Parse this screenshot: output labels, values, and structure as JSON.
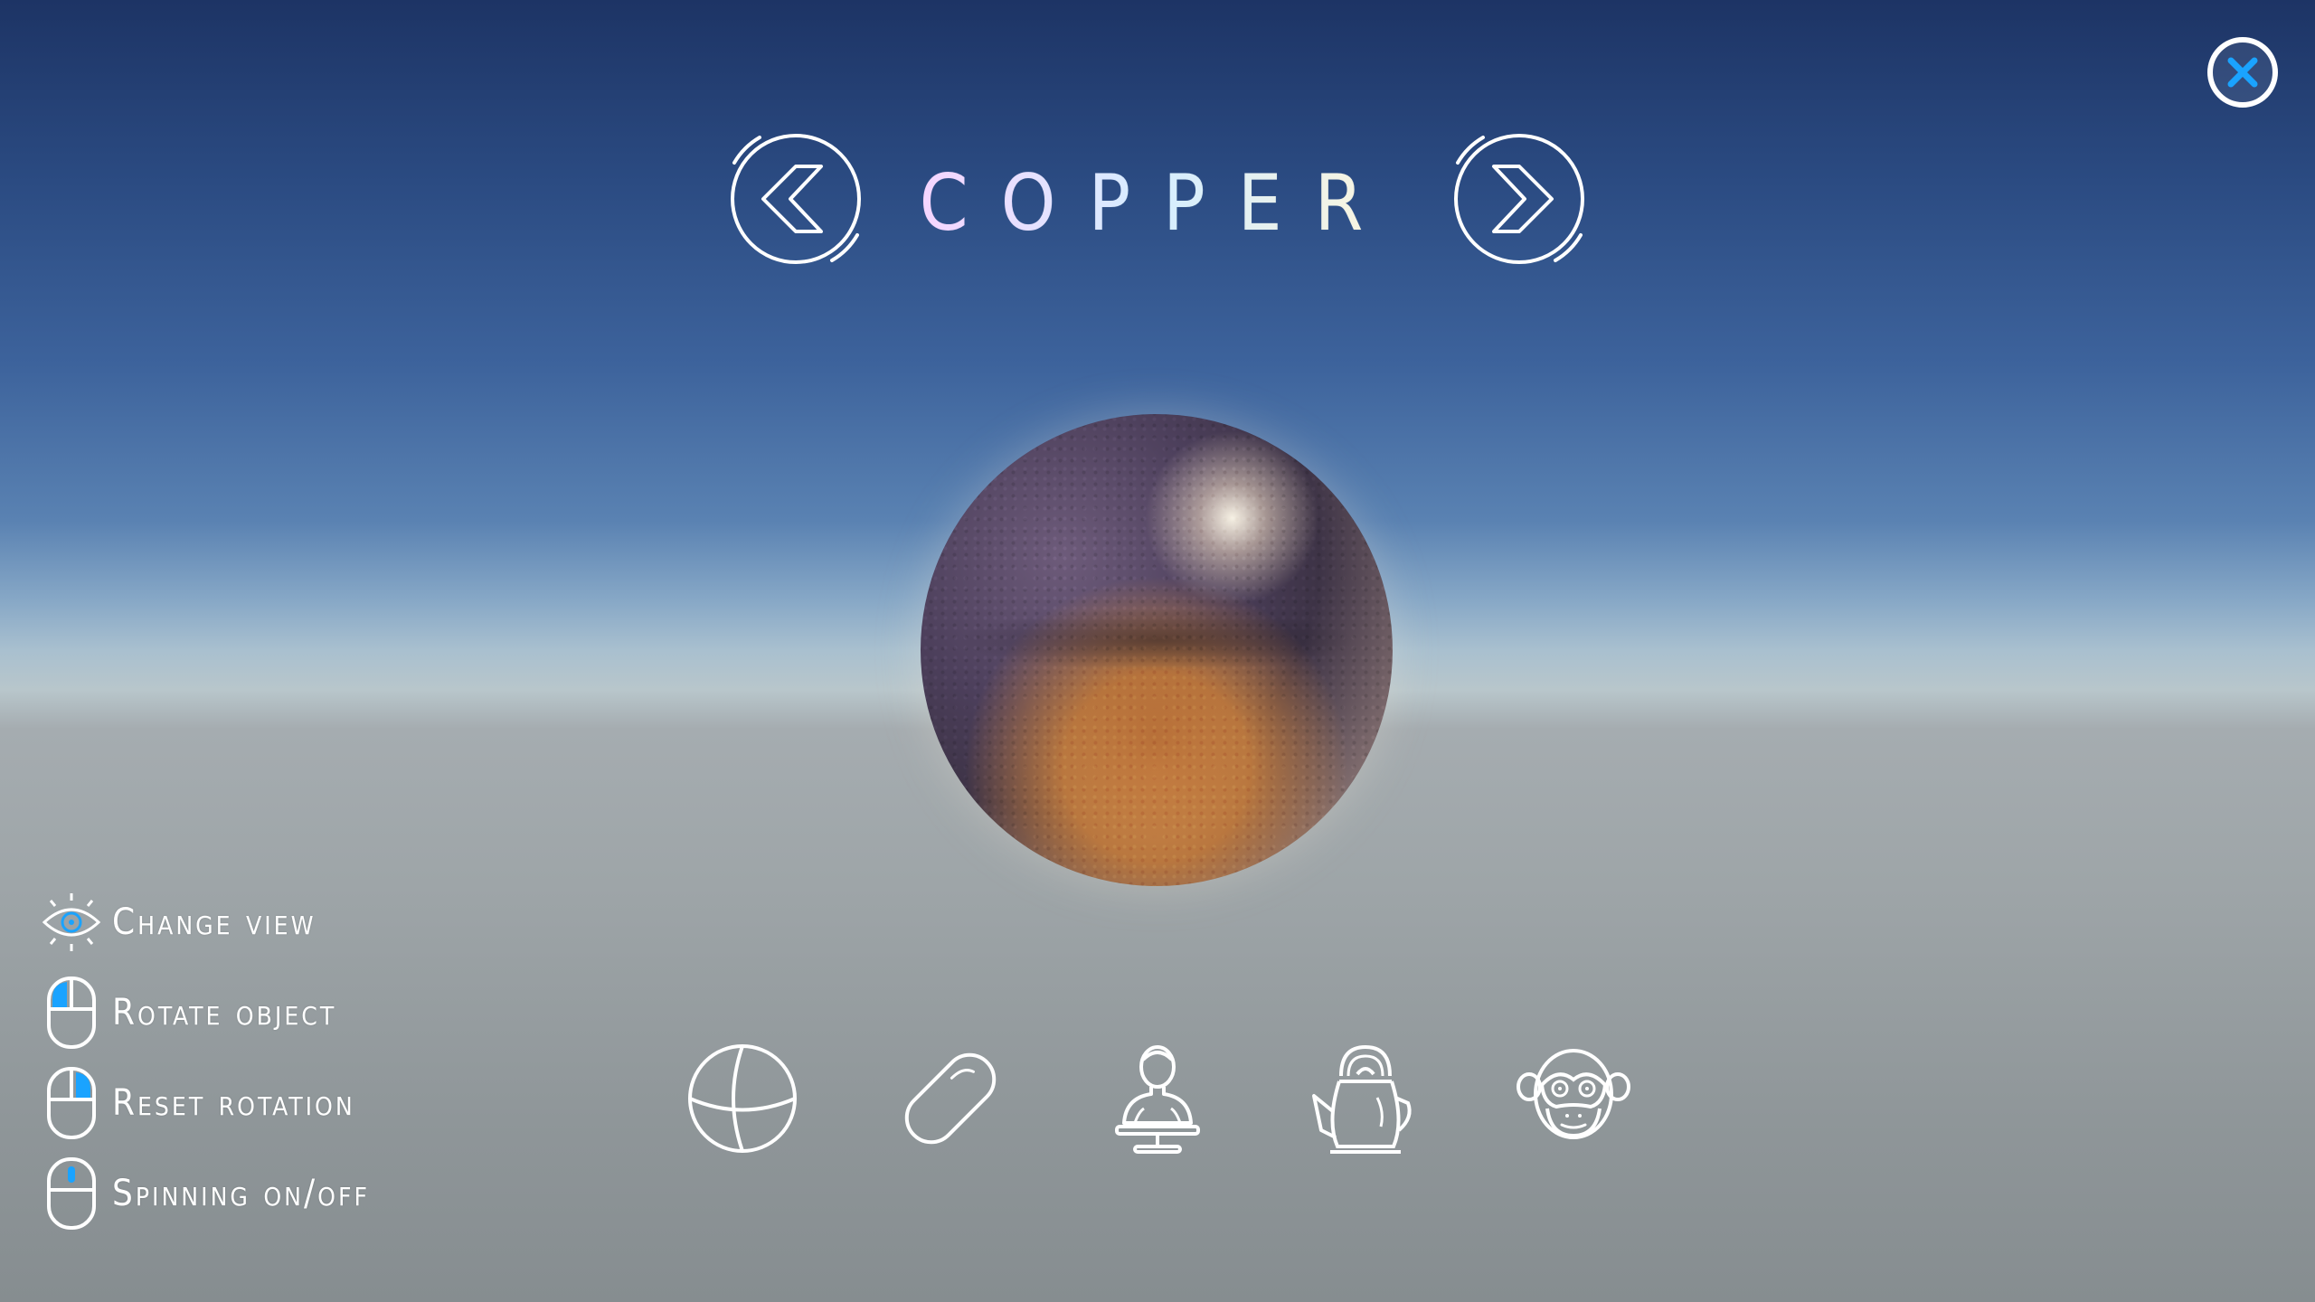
{
  "material": {
    "name": "COPPER"
  },
  "navigation": {
    "prev_icon": "chevron-left-circle-icon",
    "next_icon": "chevron-right-circle-icon",
    "close_icon": "close-icon"
  },
  "controls": [
    {
      "icon": "eye-icon",
      "label": "Change view"
    },
    {
      "icon": "mouse-left-click-icon",
      "label": "Rotate object"
    },
    {
      "icon": "mouse-right-click-icon",
      "label": "Reset rotation"
    },
    {
      "icon": "mouse-middle-click-icon",
      "label": "Spinning on/off"
    }
  ],
  "models": [
    {
      "icon": "sphere-icon"
    },
    {
      "icon": "capsule-icon"
    },
    {
      "icon": "bust-icon"
    },
    {
      "icon": "teapot-icon"
    },
    {
      "icon": "monkey-icon"
    }
  ],
  "colors": {
    "accent": "#1aa3ff",
    "icon_stroke": "#ffffff",
    "sky_top": "#1d3465",
    "horizon": "#b8c6cb",
    "ground": "#8f9699"
  }
}
